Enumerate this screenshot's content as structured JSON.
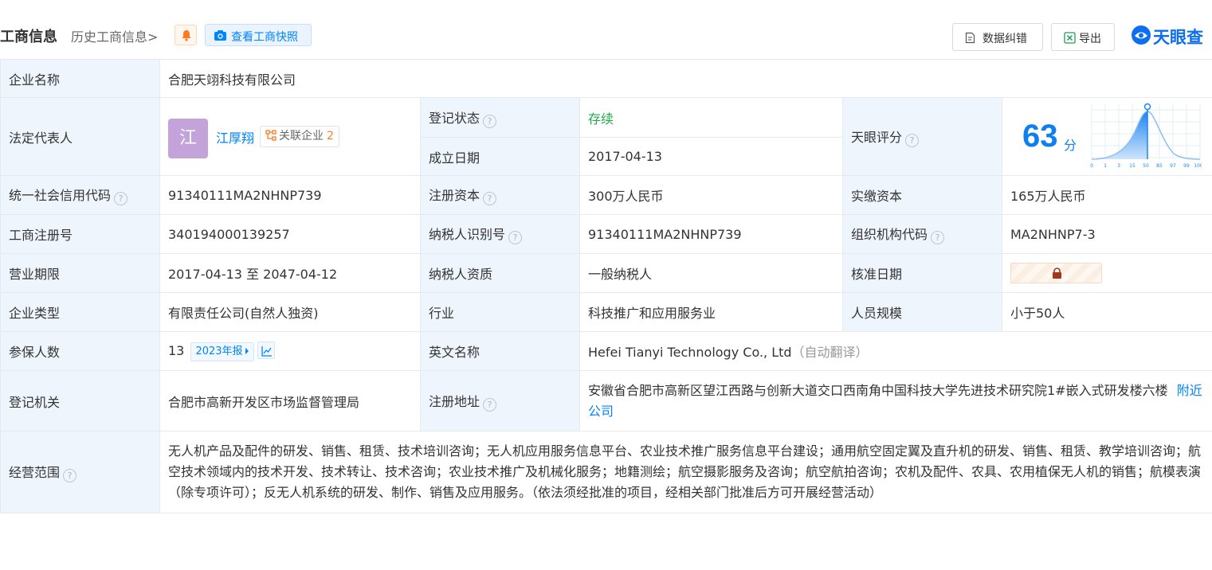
{
  "header": {
    "title": "工商信息",
    "history_label": "历史工商信息",
    "history_chevron": ">",
    "snapshot_label": "查看工商快照",
    "correct_label": "数据纠错",
    "export_label": "导出",
    "brand_name": "天眼查",
    "accent_color": "#0084ff"
  },
  "rows": {
    "company_name": {
      "label": "企业名称",
      "value": "合肥天翊科技有限公司"
    },
    "legal_rep": {
      "label": "法定代表人",
      "avatar_char": "江",
      "name": "江厚翔",
      "related_label": "关联企业",
      "related_count": "2"
    },
    "reg_status": {
      "label": "登记状态",
      "value": "存续"
    },
    "found_date": {
      "label": "成立日期",
      "value": "2017-04-13"
    },
    "score": {
      "label": "天眼评分",
      "value": "63",
      "unit": "分",
      "ticks": [
        "0",
        "1",
        "3",
        "15",
        "50",
        "85",
        "97",
        "99",
        "100"
      ]
    },
    "credit_code": {
      "label": "统一社会信用代码",
      "value": "91340111MA2NHNP739"
    },
    "reg_capital": {
      "label": "注册资本",
      "value": "300万人民币"
    },
    "paid_capital": {
      "label": "实缴资本",
      "value": "165万人民币"
    },
    "reg_number": {
      "label": "工商注册号",
      "value": "340194000139257"
    },
    "tax_id": {
      "label": "纳税人识别号",
      "value": "91340111MA2NHNP739"
    },
    "org_code": {
      "label": "组织机构代码",
      "value": "MA2NHNP7-3"
    },
    "term": {
      "label": "营业期限",
      "value": "2017-04-13 至 2047-04-12"
    },
    "tax_qual": {
      "label": "纳税人资质",
      "value": "一般纳税人"
    },
    "approve_date": {
      "label": "核准日期"
    },
    "company_type": {
      "label": "企业类型",
      "value": "有限责任公司(自然人独资)"
    },
    "industry": {
      "label": "行业",
      "value": "科技推广和应用服务业"
    },
    "staff_size": {
      "label": "人员规模",
      "value": "小于50人"
    },
    "insured": {
      "label": "参保人数",
      "value": "13",
      "year_tag": "2023年报"
    },
    "english_name": {
      "label": "英文名称",
      "value": "Hefei Tianyi Technology Co., Ltd",
      "auto_note": "（自动翻译）"
    },
    "reg_authority": {
      "label": "登记机关",
      "value": "合肥市高新开发区市场监督管理局"
    },
    "reg_address": {
      "label": "注册地址",
      "value": "安徽省合肥市高新区望江西路与创新大道交口西南角中国科技大学先进技术研究院1#嵌入式研发楼六楼",
      "nearby": "附近公司"
    },
    "scope": {
      "label": "经营范围",
      "value": "无人机产品及配件的研发、销售、租赁、技术培训咨询；无人机应用服务信息平台、农业技术推广服务信息平台建设；通用航空固定翼及直升机的研发、销售、租赁、教学培训咨询；航空技术领域内的技术开发、技术转让、技术咨询；农业技术推广及机械化服务；地籍测绘；航空摄影服务及咨询；航空航拍咨询；农机及配件、农具、农用植保无人机的销售；航模表演（除专项许可）；反无人机系统的研发、制作、销售及应用服务。（依法须经批准的项目，经相关部门批准后方可开展经营活动）"
    }
  }
}
